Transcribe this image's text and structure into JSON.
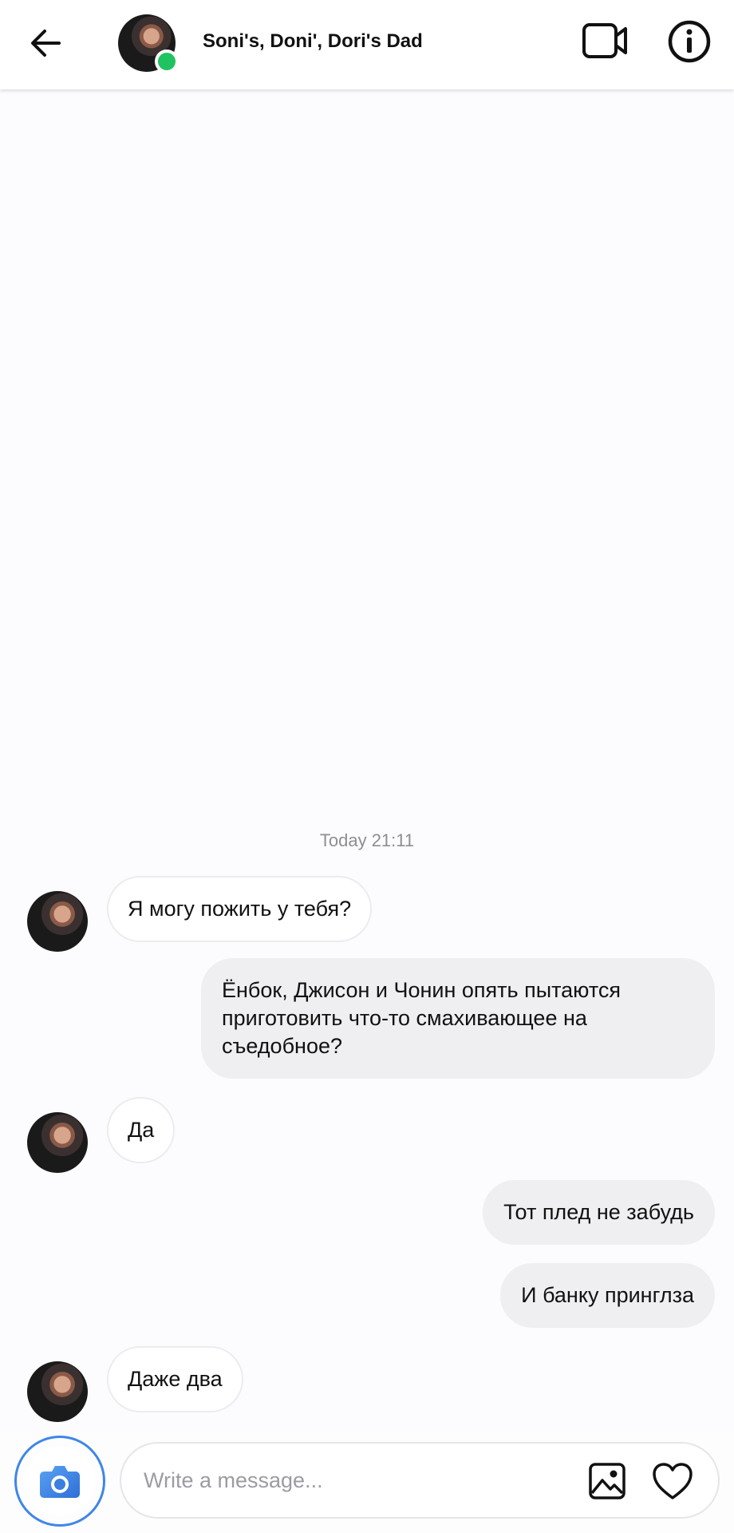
{
  "header": {
    "title": "Soni's, Doni', Dori's Dad"
  },
  "conversation": {
    "timestamp": "Today 21:11",
    "messages": [
      {
        "direction": "incoming",
        "text": "Я могу пожить у тебя?"
      },
      {
        "direction": "outgoing",
        "lines": [
          "Ёнбок, Джисон и Чонин опять пытаются",
          "приготовить что-то смахивающее на",
          "съедобное?"
        ]
      },
      {
        "direction": "incoming",
        "text": "Да"
      },
      {
        "direction": "outgoing",
        "text": "Тот плед не забудь"
      },
      {
        "direction": "outgoing",
        "text": "И банку принглза"
      },
      {
        "direction": "incoming",
        "text": "Даже два"
      }
    ]
  },
  "composer": {
    "placeholder": "Write a message..."
  },
  "icons": {
    "back": "arrow-left-icon",
    "video": "video-camera-icon",
    "info": "info-circle-icon",
    "camera": "camera-icon",
    "gallery": "image-icon",
    "like": "heart-icon"
  },
  "colors": {
    "online": "#1fc35f",
    "camera_accent": "#3f86e8",
    "incoming_bubble": "#ffffff",
    "outgoing_bubble": "#efeef1"
  }
}
